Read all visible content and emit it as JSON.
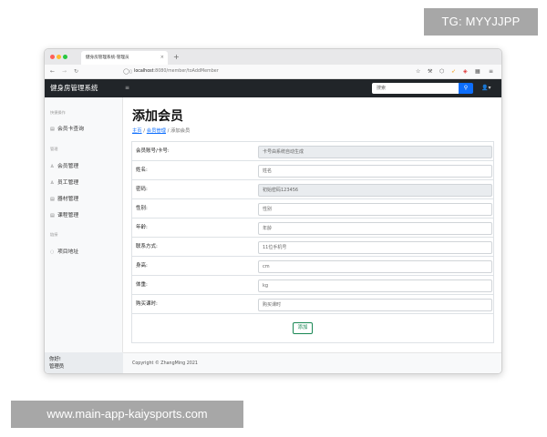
{
  "watermarks": {
    "top": "TG: MYYJJPP",
    "bottom": "www.main-app-kaiysports.com"
  },
  "browser": {
    "tab_title": "健身房管理系统-管理员",
    "tab_close": "×",
    "new_tab": "+",
    "url_host": "localhost",
    "url_rest": ":8080/member/toAddMember"
  },
  "navbar": {
    "brand": "健身房管理系统",
    "menu_icon": "≡",
    "search_placeholder": "搜索",
    "search_icon": "⚲",
    "user_icon": "👤▾"
  },
  "sidebar": {
    "sections": [
      {
        "heading": "快捷操作",
        "items": [
          {
            "label": "会员卡查询",
            "icon": "▤"
          }
        ]
      },
      {
        "heading": "管理",
        "items": [
          {
            "label": "会员管理",
            "icon": "♙"
          },
          {
            "label": "员工管理",
            "icon": "♙"
          },
          {
            "label": "器材管理",
            "icon": "▤"
          },
          {
            "label": "课程管理",
            "icon": "▤"
          }
        ]
      },
      {
        "heading": "链接",
        "items": [
          {
            "label": "项目地址",
            "icon": "◌"
          }
        ]
      }
    ],
    "footer": {
      "greeting": "你好!",
      "role": "管理员"
    }
  },
  "page": {
    "title": "添加会员",
    "breadcrumb": {
      "home": "主页",
      "sep": "/",
      "section": "会员管理",
      "current": "添加会员"
    },
    "form": [
      {
        "label": "会员账号/卡号:",
        "placeholder": "卡号由系统自动生成",
        "disabled": true
      },
      {
        "label": "姓名:",
        "placeholder": "姓名",
        "disabled": false
      },
      {
        "label": "密码:",
        "placeholder": "初始密码123456",
        "disabled": true
      },
      {
        "label": "性别:",
        "placeholder": "性别",
        "disabled": false
      },
      {
        "label": "年龄:",
        "placeholder": "年龄",
        "disabled": false
      },
      {
        "label": "联系方式:",
        "placeholder": "11位手机号",
        "disabled": false
      },
      {
        "label": "身高:",
        "placeholder": "cm",
        "disabled": false
      },
      {
        "label": "体重:",
        "placeholder": "kg",
        "disabled": false
      },
      {
        "label": "购买课时:",
        "placeholder": "购买课时",
        "disabled": false
      }
    ],
    "submit_label": "添加",
    "copyright": "Copyright © ZhangMing 2021"
  },
  "colors": {
    "navbar": "#212529",
    "primary": "#0d6efd",
    "success": "#198754"
  }
}
